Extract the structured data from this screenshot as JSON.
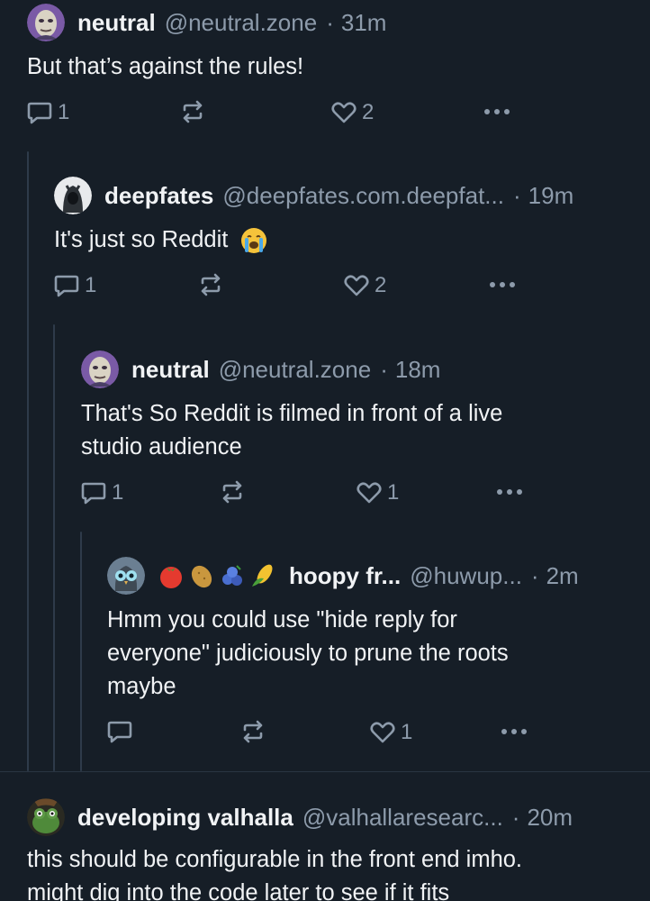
{
  "colors": {
    "background": "#161e27",
    "text": "#f1f3f5",
    "muted": "#8d9bab",
    "thread_rail": "#2e3b4a"
  },
  "posts": [
    {
      "display_name": "neutral",
      "handle": "@neutral.zone",
      "separator": "·",
      "time": "31m",
      "text": "But that’s against the rules!",
      "reply_count": "1",
      "like_count": "2",
      "avatar_icon": "cartoon-face-avatar"
    },
    {
      "display_name": "deepfates",
      "handle": "@deepfates.com.deepfat...",
      "separator": "·",
      "time": "19m",
      "text": "It's just so Reddit",
      "reaction_emoji": "loudly-crying-face",
      "reply_count": "1",
      "like_count": "2",
      "avatar_icon": "hooded-figure-avatar"
    },
    {
      "display_name": "neutral",
      "handle": "@neutral.zone",
      "separator": "·",
      "time": "18m",
      "text_line1": "That's So Reddit is filmed in front of a live",
      "text_line2": "studio audience",
      "reply_count": "1",
      "like_count": "1",
      "avatar_icon": "cartoon-face-avatar"
    },
    {
      "display_name": "hoopy fr...",
      "handle": "@huwup...",
      "separator": "·",
      "time": "2m",
      "name_emojis": [
        "tomato",
        "potato",
        "blueberries",
        "corn"
      ],
      "text_line1": "Hmm you could use \"hide reply for",
      "text_line2": "everyone\" judiciously to prune the roots",
      "text_line3": "maybe",
      "like_count": "1",
      "avatar_icon": "owl-avatar"
    },
    {
      "display_name": "developing valhalla",
      "handle": "@valhallaresearc...",
      "separator": "·",
      "time": "20m",
      "text_line1": "this should be configurable in the front end imho.",
      "text_line2": "might dig into the code later to see if it fits",
      "avatar_icon": "frog-avatar"
    }
  ]
}
